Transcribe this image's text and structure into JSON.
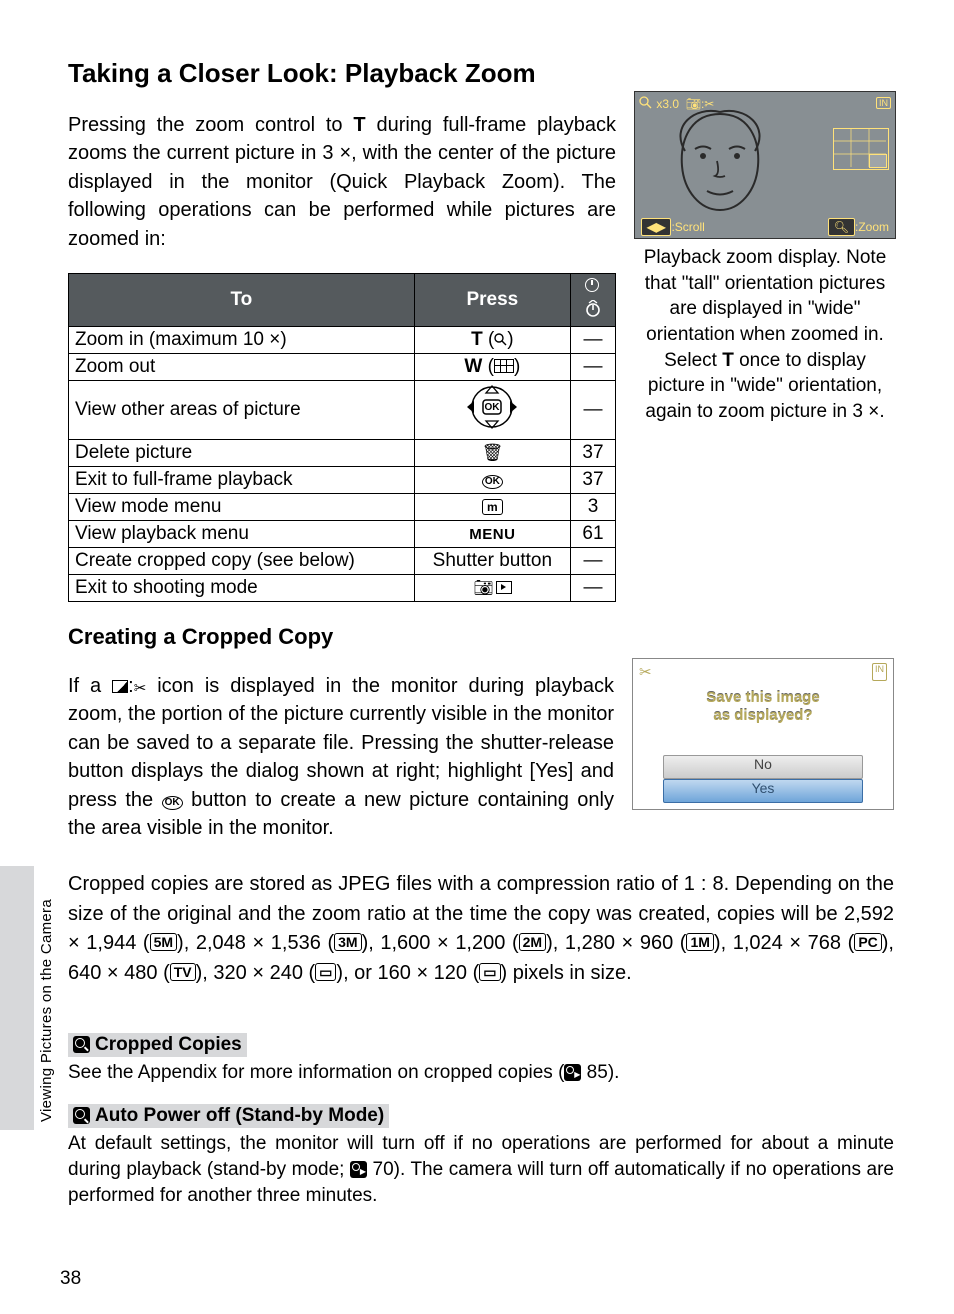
{
  "section1": {
    "heading": "Taking a Closer Look: Playback Zoom",
    "intro_a": "Pressing the zoom control to ",
    "intro_T": "T",
    "intro_b": " during full-frame playback zooms the current picture in 3 ×, with the center of the picture displayed in the monitor (Quick Playback Zoom). The following operations can be performed while pictures are zoomed in:"
  },
  "table": {
    "h1": "To",
    "h2": "Press",
    "rows": [
      {
        "to": "Zoom in (maximum 10 ×)",
        "press": "T_mag",
        "ref": "—"
      },
      {
        "to": "Zoom out",
        "press": "W_thumbs",
        "ref": "—"
      },
      {
        "to": "View other areas of picture",
        "press": "dpad",
        "ref": "—"
      },
      {
        "to": "Delete picture",
        "press": "trash",
        "ref": "37"
      },
      {
        "to": "Exit to full-frame playback",
        "press": "ok",
        "ref": "37"
      },
      {
        "to": "View mode menu",
        "press": "mbox",
        "ref": "3"
      },
      {
        "to": "View playback menu",
        "press": "menu",
        "ref": "61"
      },
      {
        "to": "Create cropped copy (see below)",
        "press": "shutter",
        "shutter_label": "Shutter button",
        "ref": "—"
      },
      {
        "to": "Exit to shooting mode",
        "press": "camplay",
        "ref": "—"
      }
    ]
  },
  "lcd1": {
    "zoom": "x3.0",
    "scroll": ":Scroll",
    "zoomlbl": ":Zoom",
    "caption_a": "Playback zoom display. Note that \"tall\" orientation pictures are displayed in \"wide\" orientation when zoomed in. Select ",
    "caption_T": "T",
    "caption_b": " once to display picture in \"wide\" orientation, again to zoom picture in 3 ×."
  },
  "section2": {
    "heading": "Creating a Cropped Copy",
    "body_a": "If a ",
    "body_b": " icon is displayed in the monitor during playback zoom, the portion of the picture currently visible in the monitor can be saved to a separate file. Pressing the shutter-release button displays the dialog shown at right; highlight [Yes] and press the ",
    "body_c": " button to create a new picture containing only the area visible in the monitor."
  },
  "lcd2": {
    "msg1": "Save this image",
    "msg2": "as displayed?",
    "no": "No",
    "yes": "Yes"
  },
  "sizes": {
    "a": "Cropped copies are stored as JPEG files with a compression ratio of 1 : 8. Depending on the size of the original and the zoom ratio at the time the copy was created, copies will be 2,592 × 1,944 (",
    "s1": "5M",
    "b": "), 2,048 × 1,536 (",
    "s2": "3M",
    "c": "), 1,600 × 1,200 (",
    "s3": "2M",
    "d": "), 1,280 × 960 (",
    "s4": "1M",
    "e": "), 1,024 × 768 (",
    "s5": "PC",
    "f": "), 640 × 480 (",
    "s6": "TV",
    "g": "), 320 × 240 (",
    "s7": "⌐",
    "h": "), or 160 × 120 (",
    "s8": "⌐",
    "i": ") pixels in size."
  },
  "note1": {
    "title": "Cropped Copies",
    "body_a": "See the Appendix for more information on cropped copies (",
    "ref": " 85).",
    "ref_num": "85"
  },
  "note2": {
    "title": "Auto Power off (Stand-by Mode)",
    "body_a": "At default settings, the monitor will turn off if no operations are performed for about a minute during playback (stand-by mode; ",
    "ref": " 70). The camera will turn off automatically if no operations are performed for another three minutes.",
    "ref_num": "70"
  },
  "side": "Viewing Pictures on the Camera",
  "page": "38"
}
